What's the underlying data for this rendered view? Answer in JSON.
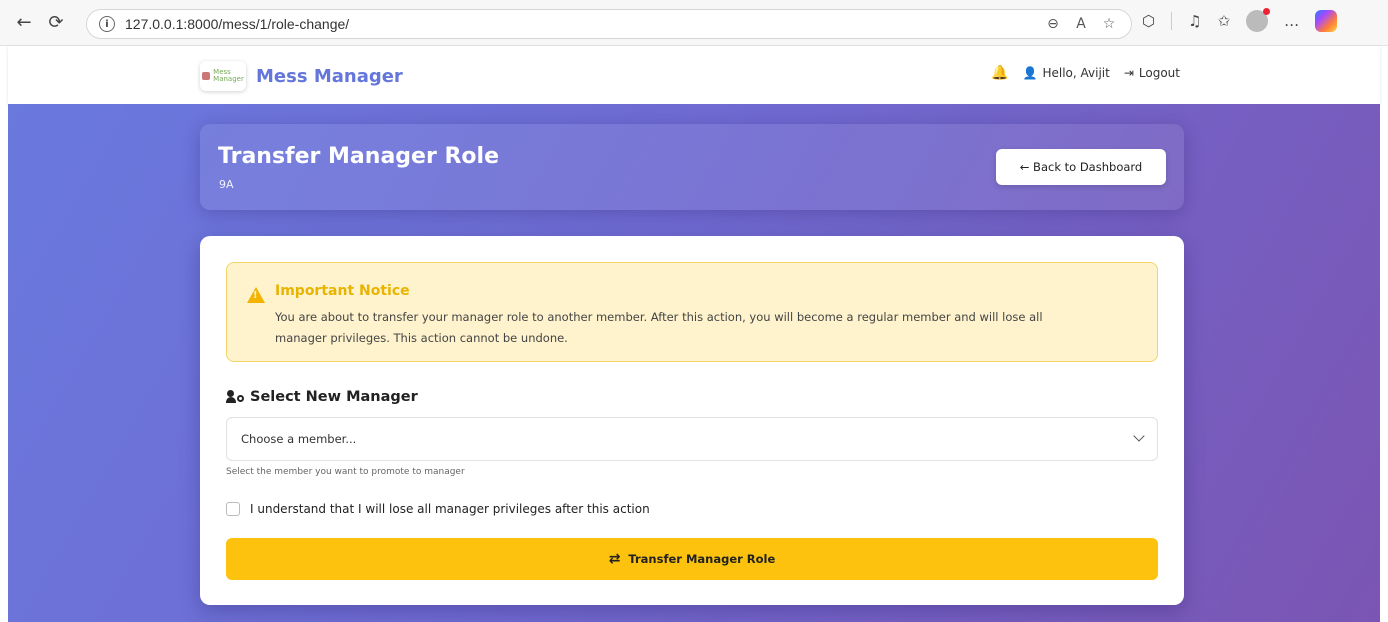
{
  "browser": {
    "url": "127.0.0.1:8000/mess/1/role-change/"
  },
  "navbar": {
    "brand_name": "Mess Manager",
    "greeting": "Hello, Avijit",
    "logout_label": "Logout"
  },
  "header": {
    "title": "Transfer Manager Role",
    "subtitle": "9A",
    "back_button": "← Back to Dashboard"
  },
  "notice": {
    "title": "Important Notice",
    "text": "You are about to transfer your manager role to another member. After this action, you will become a regular member and will lose all manager privileges. This action cannot be undone."
  },
  "form": {
    "select_label": "Select New Manager",
    "select_placeholder": "Choose a member...",
    "help_text": "Select the member you want to promote to manager",
    "checkbox_label": "I understand that I will lose all manager privileges after this action",
    "submit_label": "Transfer Manager Role"
  },
  "colors": {
    "brand": "#6476db",
    "gradient_start": "#6a79de",
    "gradient_end": "#7b55b3",
    "warning": "#fcc20d"
  }
}
